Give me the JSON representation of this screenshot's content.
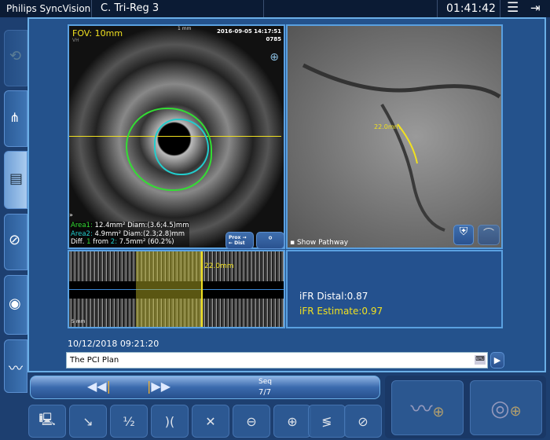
{
  "topbar": {
    "app": "Philips SyncVision",
    "title": "C. Tri-Reg 3",
    "clock": "01:41:42",
    "menu_icon": "hamburger-icon",
    "exit_icon": "exit-icon"
  },
  "ivus": {
    "fov": "FOV: 10mm",
    "sub": "VH",
    "scale": "1 mm",
    "datetime": "2016-09-05 14:17:51",
    "frame": "0785",
    "area1_label": "Area1:",
    "area1": "12.4mm² Diam:(3.6;4.5)mm",
    "area2_label": "Area2:",
    "area2": "4.9mm² Diam:(2.3;2.8)mm",
    "diff_pre": "Diff.",
    "diff_a": "1",
    "diff_from": "from",
    "diff_b": "2:",
    "diff": "7.5mm²  (60.2%)",
    "prox": "Prox →",
    "dist": "← Dist",
    "colors": {
      "area1": "#33dd33",
      "area2": "#22cccc",
      "marker": "#f0e020"
    }
  },
  "angio": {
    "length": "22.0mm",
    "show_pathway": "Show Pathway"
  },
  "longview": {
    "length": "22.0mm",
    "scale": "5 mm"
  },
  "ifr": {
    "distal": "iFR Distal:0.87",
    "estimate": "iFR Estimate:0.97"
  },
  "record": {
    "datetime": "10/12/2018 09:21:20",
    "note": "The PCI Plan"
  },
  "sequence": {
    "label": "Seq",
    "value": "7/7"
  },
  "toolbar": [
    "monitor-user",
    "pullback",
    "two-point",
    "vessel-marker",
    "cross-section",
    "zoom-out",
    "zoom-in",
    "align",
    "catheter"
  ],
  "big_buttons": [
    "add-ifr",
    "add-ivus"
  ]
}
